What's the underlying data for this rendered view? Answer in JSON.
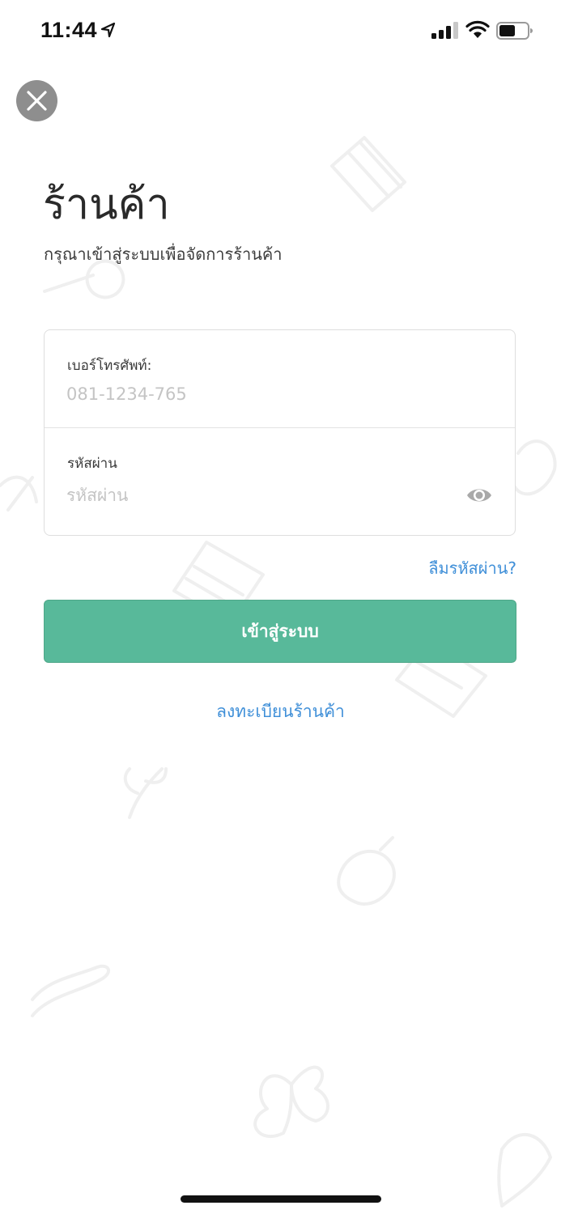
{
  "status_bar": {
    "time": "11:44",
    "icons": [
      "location-arrow-icon",
      "cellular-signal-icon",
      "wifi-icon",
      "battery-icon"
    ]
  },
  "close_button": {
    "icon": "close-icon"
  },
  "header": {
    "title": "ร้านค้า",
    "subtitle": "กรุณาเข้าสู่ระบบเพื่อจัดการร้านค้า"
  },
  "form": {
    "phone": {
      "label": "เบอร์โทรศัพท์:",
      "value": "",
      "placeholder": "081-1234-765"
    },
    "password": {
      "label": "รหัสผ่าน",
      "value": "",
      "placeholder": "รหัสผ่าน",
      "toggle_icon": "eye-icon"
    },
    "forgot_password": "ลืมรหัสผ่าน?"
  },
  "login_button": "เข้าสู่ระบบ",
  "register_link": "ลงทะเบียนร้านค้า",
  "colors": {
    "accent_green": "#58b99a",
    "link_blue": "#3f8fd8",
    "close_gray": "#8e8e8e"
  }
}
